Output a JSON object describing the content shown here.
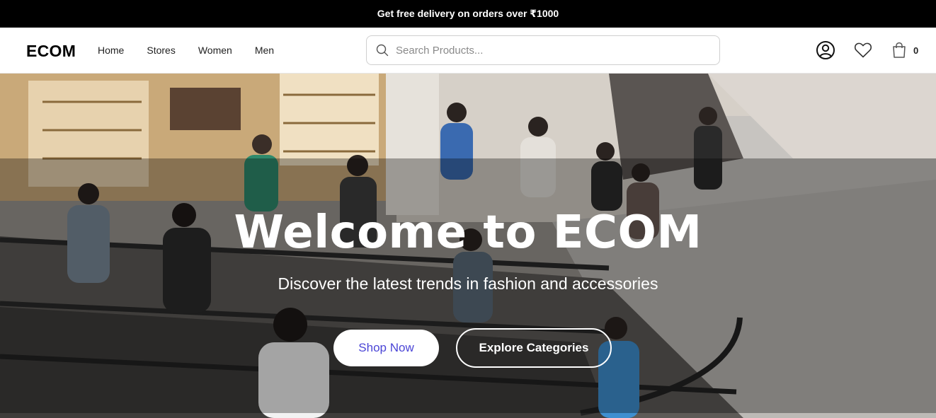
{
  "promo": {
    "text": "Get free delivery on orders over ₹1000"
  },
  "header": {
    "logo": "ECOM",
    "nav": [
      "Home",
      "Stores",
      "Women",
      "Men"
    ],
    "search": {
      "placeholder": "Search Products...",
      "value": ""
    },
    "icons": [
      "user-icon",
      "heart-icon",
      "shopping-bag-icon"
    ],
    "cart_count": "0"
  },
  "hero": {
    "title": "Welcome to ECOM",
    "subtitle": "Discover the latest trends in fashion and accessories",
    "primary_button": "Shop Now",
    "secondary_button": "Explore Categories",
    "colors": {
      "primary_button_text": "#4b45d6",
      "overlay": "rgba(0,0,0,0.32)"
    }
  }
}
